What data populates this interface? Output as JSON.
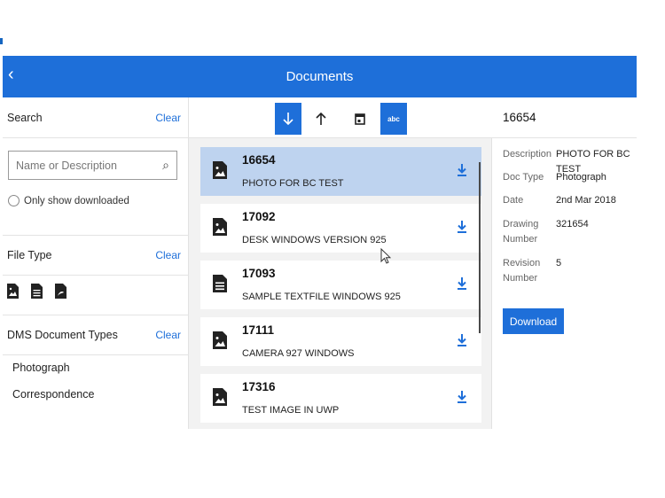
{
  "header": {
    "title": "Documents",
    "back_glyph": "‹"
  },
  "search": {
    "label": "Search",
    "clear": "Clear",
    "placeholder": "Name or Description",
    "only_downloaded": "Only show downloaded"
  },
  "file_type": {
    "label": "File Type",
    "clear": "Clear",
    "icons": [
      "image-file-icon",
      "text-file-icon",
      "pdf-file-icon"
    ]
  },
  "dms": {
    "label": "DMS Document Types",
    "clear": "Clear",
    "items": [
      "Photograph",
      "Correspondence"
    ]
  },
  "toolbar": {
    "active": [
      "sort-descending",
      "filter-abc"
    ],
    "abc_label": "abc"
  },
  "documents": [
    {
      "number": "16654",
      "description": "PHOTO FOR BC TEST",
      "icon": "image-file-icon",
      "selected": true
    },
    {
      "number": "17092",
      "description": "DESK WINDOWS VERSION 925",
      "icon": "image-file-icon",
      "selected": false
    },
    {
      "number": "17093",
      "description": "SAMPLE TEXTFILE WINDOWS 925",
      "icon": "text-file-icon",
      "selected": false
    },
    {
      "number": "17111",
      "description": "CAMERA 927 WINDOWS",
      "icon": "image-file-icon",
      "selected": false
    },
    {
      "number": "17316",
      "description": "TEST IMAGE IN UWP",
      "icon": "image-file-icon",
      "selected": false
    }
  ],
  "detail": {
    "title": "16654",
    "description_label": "Description",
    "description_value": "PHOTO FOR BC TEST",
    "doctype_label": "Doc Type",
    "doctype_value": "Photograph",
    "date_label": "Date",
    "date_value": "2nd Mar 2018",
    "drawing_label_1": "Drawing",
    "drawing_label_2": "Number",
    "drawing_value": "321654",
    "revision_label_1": "Revision",
    "revision_label_2": "Number",
    "revision_value": "5",
    "download": "Download"
  },
  "colors": {
    "accent": "#1e6fd9",
    "selected_row": "#bed3ef"
  }
}
